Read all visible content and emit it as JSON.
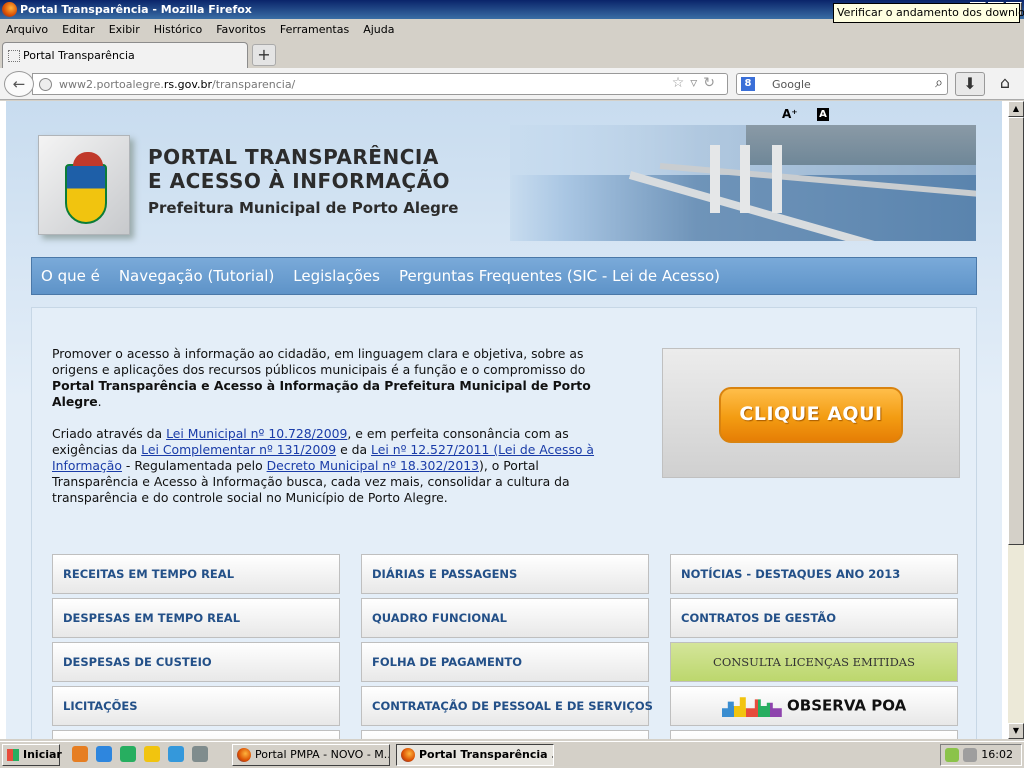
{
  "window": {
    "title": "Portal Transparência - Mozilla Firefox"
  },
  "menu": [
    "Arquivo",
    "Editar",
    "Exibir",
    "Histórico",
    "Favoritos",
    "Ferramentas",
    "Ajuda"
  ],
  "tab": {
    "label": "Portal Transparência",
    "new_tab": "+"
  },
  "url": {
    "prefix": "www2.portoalegre.",
    "domain": "rs.gov.br",
    "path": "/transparencia/"
  },
  "search": {
    "engine_icon": "8",
    "placeholder": "Google"
  },
  "tooltip": "Verificar o andamento dos downloads",
  "font_controls": {
    "increase": "A⁺",
    "contrast": "A"
  },
  "header": {
    "title_line1": "PORTAL TRANSPARÊNCIA",
    "title_line2": "E ACESSO À INFORMAÇÃO",
    "subtitle": "Prefeitura Municipal de Porto Alegre"
  },
  "nav": [
    "O que é",
    "Navegação (Tutorial)",
    "Legislações",
    "Perguntas Frequentes (SIC - Lei de Acesso)"
  ],
  "intro": {
    "p1_text": "Promover o acesso à informação ao cidadão, em linguagem clara e objetiva, sobre as origens e aplicações dos recursos públicos municipais é a função e o compromisso do ",
    "p1_bold": "Portal Transparência e Acesso à Informação da Prefeitura Municipal de Porto Alegre",
    "p1_end": ".",
    "p2_a": "Criado através da ",
    "p2_link1": "Lei Municipal nº 10.728/2009",
    "p2_b": ", e em perfeita consonância com as exigências da ",
    "p2_link2": "Lei  Complementar  nº 131/2009",
    "p2_c": " e da ",
    "p2_link3": "Lei  nº 12.527/2011 (Lei de Acesso à Informação",
    "p2_d": " - Regulamentada pelo ",
    "p2_link4": "Decreto Municipal nº 18.302/2013",
    "p2_e": "),  o Portal Transparência e Acesso à Informação busca, cada vez mais, consolidar a cultura da transparência e do controle social no Município de Porto Alegre."
  },
  "cta": {
    "label": "CLIQUE AQUI"
  },
  "buttons": {
    "col1": [
      "RECEITAS EM TEMPO REAL",
      "DESPESAS EM TEMPO REAL",
      "DESPESAS DE CUSTEIO",
      "LICITAÇÕES"
    ],
    "col2": [
      "DIÁRIAS E PASSAGENS",
      "QUADRO FUNCIONAL",
      "FOLHA DE PAGAMENTO",
      "CONTRATAÇÃO DE PESSOAL E DE SERVIÇOS"
    ],
    "col3": [
      "NOTÍCIAS - DESTAQUES ANO 2013",
      "CONTRATOS DE GESTÃO"
    ],
    "licencas": "CONSULTA LICENÇAS EMITIDAS",
    "observa": "OBSERVA POA"
  },
  "taskbar": {
    "start": "Iniciar",
    "task1": "Portal PMPA - NOVO - M...",
    "task2": "Portal Transparência ...",
    "clock": "16:02"
  }
}
